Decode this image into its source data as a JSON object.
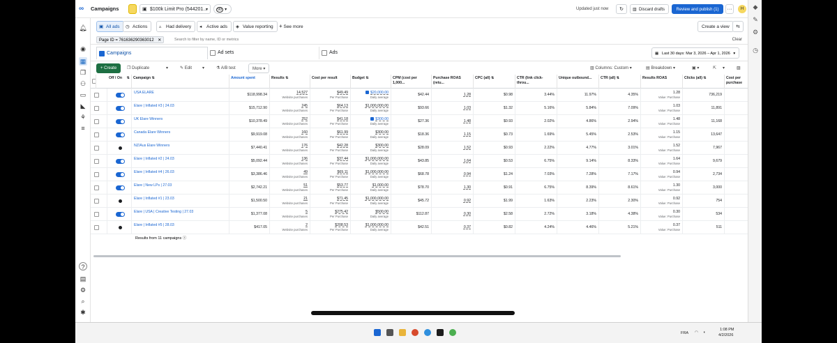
{
  "topbar": {
    "title": "Campaigns",
    "account": "$100k Limit Pro (544201...",
    "account_badge": "90",
    "updated": "Updated just now",
    "discard": "Discard drafts",
    "review": "Review and publish (1)",
    "more": "···",
    "avatar": "H"
  },
  "filters": {
    "all_ads": "All ads",
    "actions": "Actions",
    "had_delivery": "Had delivery",
    "active_ads": "Active ads",
    "value_reporting": "Value reporting",
    "see_more": "See more",
    "create_view": "Create a view"
  },
  "search": {
    "chip": "Page ID = 761636290363012",
    "placeholder": "Search to filter by name, ID or metrics",
    "clear": "Clear"
  },
  "tabs": [
    {
      "label": "Campaigns"
    },
    {
      "label": "Ad sets"
    },
    {
      "label": "Ads"
    }
  ],
  "date_range": "Last 30 days: Mar 3, 2026 – Apr 1, 2026",
  "toolbar": {
    "create": "Create",
    "duplicate": "Duplicate",
    "edit": "Edit",
    "ab_test": "A/B test",
    "more": "More",
    "columns": "Columns: Custom",
    "breakdown": "Breakdown"
  },
  "columns": {
    "offon": "Off / On",
    "campaign": "Campaign",
    "amount": "Amount spent",
    "results": "Results",
    "cost": "Cost per result",
    "budget": "Budget",
    "cpm": "CPM (cost per 1,000...",
    "roas": "Purchase ROAS (retu...",
    "cpc": "CPC (all)",
    "ctr_link": "CTR (link click-throu...",
    "unique": "Unique outbound...",
    "ctr_all": "CTR (all)",
    "results_roas": "Results ROAS",
    "clicks": "Clicks (all)",
    "cost_per": "Cost per purchase"
  },
  "rows": [
    {
      "name": "USA ELARE",
      "status": "on",
      "amount": "$118,998.34",
      "results": "14,527",
      "results_sub": "Website purchases",
      "cost": "$49.49",
      "cost_sub": "Per Purchase",
      "budget": "$20,000.00",
      "budget_sub": "Daily average",
      "budget_icon": true,
      "cpm": "$42.44",
      "roas": "1.28",
      "cpc": "$0.98",
      "ctr_link": "3.44%",
      "unique": "11.97%",
      "ctr_all": "4.35%",
      "results_roas": "1.28",
      "rr_sub": "Value: Purchase",
      "clicks": "736,219"
    },
    {
      "name": "Elare | Inflated #3 | 24.03",
      "status": "on",
      "amount": "$15,712.90",
      "results": "245",
      "results_sub": "Website purchases",
      "cost": "$64.13",
      "cost_sub": "Per Purchase",
      "budget": "$1,000,000.00",
      "budget_sub": "Daily average",
      "budget_icon": false,
      "cpm": "$93.66",
      "roas": "1.03",
      "cpc": "$1.32",
      "ctr_link": "5.16%",
      "unique": "5.84%",
      "ctr_all": "7.09%",
      "results_roas": "1.03",
      "rr_sub": "Value: Purchase",
      "clicks": "11,891"
    },
    {
      "name": "UK Elare Winners",
      "status": "on",
      "amount": "$10,378.49",
      "results": "252",
      "results_sub": "Website purchases",
      "cost": "$41.18",
      "cost_sub": "Per Purchase",
      "budget": "$300.00",
      "budget_sub": "Daily average",
      "budget_icon": true,
      "cpm": "$27.36",
      "roas": "1.48",
      "cpc": "$0.93",
      "ctr_link": "2.02%",
      "unique": "4.86%",
      "ctr_all": "2.94%",
      "results_roas": "1.48",
      "rr_sub": "Value: Purchase",
      "clicks": "11,168"
    },
    {
      "name": "Canada Elare Winners",
      "status": "on",
      "amount": "$9,919.08",
      "results": "160",
      "results_sub": "Website purchases",
      "cost": "$61.99",
      "cost_sub": "Per Purchase",
      "budget": "$300.00",
      "budget_sub": "Daily average",
      "budget_icon": false,
      "cpm": "$18.36",
      "roas": "1.15",
      "cpc": "$0.73",
      "ctr_link": "1.69%",
      "unique": "5.45%",
      "ctr_all": "2.53%",
      "results_roas": "1.15",
      "rr_sub": "Value: Purchase",
      "clicks": "13,647"
    },
    {
      "name": "NZ/Aus Elare Winners",
      "status": "off",
      "amount": "$7,440.41",
      "results": "176",
      "results_sub": "Website purchases",
      "cost": "$42.28",
      "cost_sub": "Per Purchase",
      "budget": "$300.00",
      "budget_sub": "Daily average",
      "budget_icon": false,
      "cpm": "$28.09",
      "roas": "1.52",
      "cpc": "$0.93",
      "ctr_link": "2.22%",
      "unique": "4.77%",
      "ctr_all": "3.01%",
      "results_roas": "1.52",
      "rr_sub": "Value: Purchase",
      "clicks": "7,967"
    },
    {
      "name": "Elare | Inflated #2 | 24.03",
      "status": "on",
      "amount": "$5,092.44",
      "results": "136",
      "results_sub": "Website purchases",
      "cost": "$37.44",
      "cost_sub": "Per Purchase",
      "budget": "$1,000,000.00",
      "budget_sub": "Daily average",
      "budget_icon": false,
      "cpm": "$43.85",
      "roas": "1.64",
      "cpc": "$0.53",
      "ctr_link": "6.75%",
      "unique": "9.14%",
      "ctr_all": "8.33%",
      "results_roas": "1.64",
      "rr_sub": "Value: Purchase",
      "clicks": "9,679"
    },
    {
      "name": "Elare | Inflated #4 | 26.03",
      "status": "on",
      "amount": "$3,386.46",
      "results": "49",
      "results_sub": "Website purchases",
      "cost": "$69.11",
      "cost_sub": "Per Purchase",
      "budget": "$1,000,000.00",
      "budget_sub": "Daily average",
      "budget_icon": false,
      "cpm": "$68.78",
      "roas": "0.94",
      "cpc": "$1.24",
      "ctr_link": "7.03%",
      "unique": "7.28%",
      "ctr_all": "7.17%",
      "results_roas": "0.94",
      "rr_sub": "Value: Purchase",
      "clicks": "2,734"
    },
    {
      "name": "Elare | New LPs | 27.03",
      "status": "on",
      "amount": "$2,742.21",
      "results": "51",
      "results_sub": "Website purchases",
      "cost": "$53.77",
      "cost_sub": "Per Purchase",
      "budget": "$1,000.00",
      "budget_sub": "Daily average",
      "budget_icon": false,
      "cpm": "$78.70",
      "roas": "1.30",
      "cpc": "$0.91",
      "ctr_link": "6.75%",
      "unique": "8.39%",
      "ctr_all": "8.61%",
      "results_roas": "1.30",
      "rr_sub": "Value: Purchase",
      "clicks": "3,000"
    },
    {
      "name": "Elare | Inflated #1 | 23.03",
      "status": "off",
      "amount": "$1,500.50",
      "results": "21",
      "results_sub": "Website purchases",
      "cost": "$71.45",
      "cost_sub": "Per Purchase",
      "budget": "$1,000,000.00",
      "budget_sub": "Daily average",
      "budget_icon": false,
      "cpm": "$45.72",
      "roas": "0.92",
      "cpc": "$1.99",
      "ctr_link": "1.63%",
      "unique": "2.23%",
      "ctr_all": "2.30%",
      "results_roas": "0.92",
      "rr_sub": "Value: Purchase",
      "clicks": "754"
    },
    {
      "name": "Elare | USA | Creative Testing | 27.03",
      "status": "on",
      "amount": "$1,377.08",
      "results": "5",
      "results_sub": "Website purchases",
      "cost": "$275.42",
      "cost_sub": "Per Purchase",
      "budget": "$500.00",
      "budget_sub": "Daily average",
      "budget_icon": false,
      "cpm": "$112.87",
      "roas": "0.30",
      "cpc": "$2.58",
      "ctr_link": "2.72%",
      "unique": "3.18%",
      "ctr_all": "4.38%",
      "results_roas": "0.30",
      "rr_sub": "Value: Purchase",
      "clicks": "534"
    },
    {
      "name": "Elare | Inflated #5 | 28.03",
      "status": "off",
      "amount": "$417.05",
      "results": "2",
      "results_sub": "Website purchases",
      "cost": "$208.53",
      "cost_sub": "Per Purchase",
      "budget": "$1,000,000.00",
      "budget_sub": "Daily average",
      "budget_icon": false,
      "cpm": "$42.51",
      "roas": "0.37",
      "cpc": "$0.82",
      "ctr_link": "4.24%",
      "unique": "4.46%",
      "ctr_all": "5.21%",
      "results_roas": "0.37",
      "rr_sub": "Value: Purchase",
      "clicks": "511"
    }
  ],
  "footer": {
    "summary": "Results from 11 campaigns"
  },
  "taskbar": {
    "lang": "FRA",
    "time": "1:08 PM",
    "date": "4/2/2026"
  },
  "colors": {
    "accent": "#1a66d2",
    "create": "#1d6f42",
    "toggle_off": "#c9ccd1"
  }
}
